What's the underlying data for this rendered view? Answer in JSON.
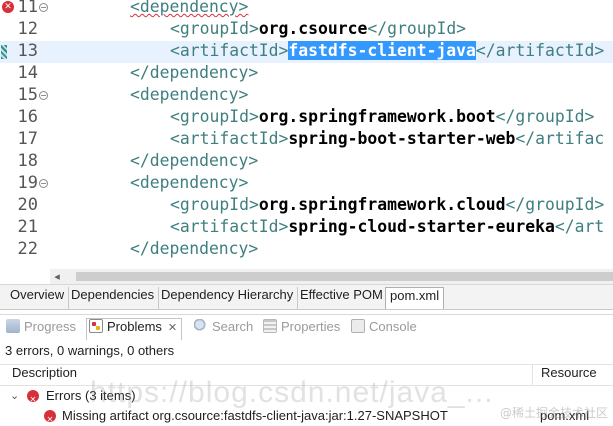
{
  "editor": {
    "file": "pom.xml",
    "lines": [
      {
        "num": "11",
        "indent": 2,
        "tag_open": "<dependency>",
        "text": "",
        "tag_close": "",
        "marker": "error",
        "fold": true,
        "squiggle": true
      },
      {
        "num": "12",
        "indent": 3,
        "tag_open": "<groupId>",
        "text": "org.csource",
        "tag_close": "</groupId>",
        "marker": "",
        "fold": false
      },
      {
        "num": "13",
        "indent": 3,
        "tag_open": "<artifactId>",
        "text": "fastdfs-client-java",
        "tag_close": "</artifactId>",
        "marker": "change",
        "fold": false,
        "selected": true,
        "current": true
      },
      {
        "num": "14",
        "indent": 2,
        "tag_open": "</dependency>",
        "text": "",
        "tag_close": "",
        "marker": "",
        "fold": false
      },
      {
        "num": "15",
        "indent": 2,
        "tag_open": "<dependency>",
        "text": "",
        "tag_close": "",
        "marker": "",
        "fold": true
      },
      {
        "num": "16",
        "indent": 3,
        "tag_open": "<groupId>",
        "text": "org.springframework.boot",
        "tag_close": "</groupId>",
        "marker": "",
        "fold": false
      },
      {
        "num": "17",
        "indent": 3,
        "tag_open": "<artifactId>",
        "text": "spring-boot-starter-web",
        "tag_close": "</artifac",
        "marker": "",
        "fold": false
      },
      {
        "num": "18",
        "indent": 2,
        "tag_open": "</dependency>",
        "text": "",
        "tag_close": "",
        "marker": "",
        "fold": false
      },
      {
        "num": "19",
        "indent": 2,
        "tag_open": "<dependency>",
        "text": "",
        "tag_close": "",
        "marker": "",
        "fold": true
      },
      {
        "num": "20",
        "indent": 3,
        "tag_open": "<groupId>",
        "text": "org.springframework.cloud",
        "tag_close": "</groupId>",
        "marker": "",
        "fold": false
      },
      {
        "num": "21",
        "indent": 3,
        "tag_open": "<artifactId>",
        "text": "spring-cloud-starter-eureka",
        "tag_close": "</art",
        "marker": "",
        "fold": false
      },
      {
        "num": "22",
        "indent": 2,
        "tag_open": "</dependency>",
        "text": "",
        "tag_close": "",
        "marker": "",
        "fold": false
      }
    ]
  },
  "pom_tabs": [
    {
      "label": "Overview",
      "active": false
    },
    {
      "label": "Dependencies",
      "active": false
    },
    {
      "label": "Dependency Hierarchy",
      "active": false
    },
    {
      "label": "Effective POM",
      "active": false
    },
    {
      "label": "pom.xml",
      "active": true
    }
  ],
  "views": [
    {
      "label": "Progress",
      "icon": "progress-icon",
      "active": false
    },
    {
      "label": "Problems",
      "icon": "problems-icon",
      "active": true,
      "close": "✕"
    },
    {
      "label": "Search",
      "icon": "search-icon",
      "active": false
    },
    {
      "label": "Properties",
      "icon": "properties-icon",
      "active": false
    },
    {
      "label": "Console",
      "icon": "console-icon",
      "active": false
    }
  ],
  "problems": {
    "summary": "3 errors, 0 warnings, 0 others",
    "columns": {
      "description": "Description",
      "resource": "Resource"
    },
    "group": {
      "label": "Errors (3 items)",
      "expander": "⌄"
    },
    "rows": [
      {
        "description": "Missing artifact org.csource:fastdfs-client-java:jar:1.27-SNAPSHOT",
        "resource": "pom.xml"
      }
    ]
  },
  "watermark": {
    "text": "https://blog.csdn.net/java_...",
    "corner": "@稀土掘金技术社区"
  },
  "colors": {
    "tag": "#3f7f7f",
    "selection": "#3399ff",
    "current_line": "#e8f2fe",
    "error": "#d6303a"
  }
}
